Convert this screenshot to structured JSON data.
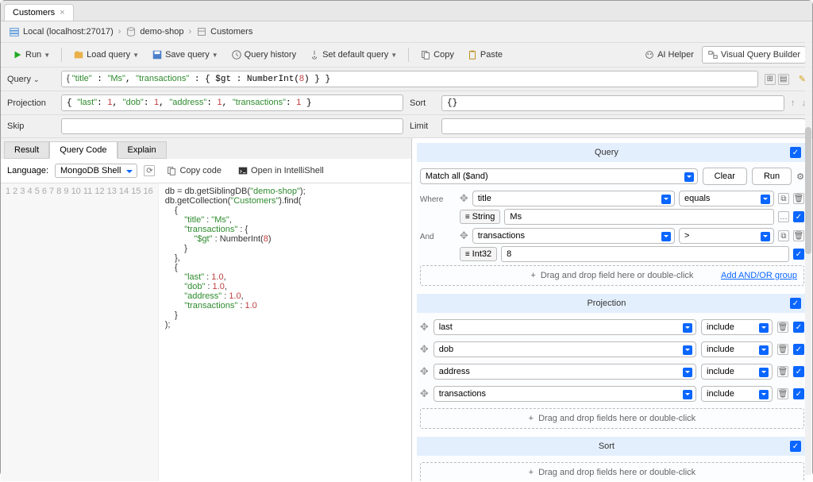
{
  "tab": {
    "title": "Customers"
  },
  "breadcrumb": {
    "host": "Local (localhost:27017)",
    "db": "demo-shop",
    "coll": "Customers"
  },
  "toolbar": {
    "run": "Run",
    "load": "Load query",
    "save": "Save query",
    "history": "Query history",
    "default": "Set default query",
    "copy": "Copy",
    "paste": "Paste",
    "ai": "AI Helper",
    "vqb": "Visual Query Builder"
  },
  "query": {
    "label": "Query",
    "value": "{ \"title\" : \"Ms\", \"transactions\" : { $gt : NumberInt(8) } }"
  },
  "projection": {
    "label": "Projection",
    "value": "{ \"last\": 1, \"dob\": 1, \"address\": 1, \"transactions\": 1 }"
  },
  "sort": {
    "label": "Sort",
    "value": "{}"
  },
  "skip": {
    "label": "Skip",
    "value": ""
  },
  "limit": {
    "label": "Limit",
    "value": ""
  },
  "restabs": {
    "result": "Result",
    "code": "Query Code",
    "explain": "Explain"
  },
  "lang": {
    "label": "Language:",
    "value": "MongoDB Shell",
    "copy": "Copy code",
    "open": "Open in IntelliShell"
  },
  "code_lines": 16,
  "vqb_panel": {
    "query_hdr": "Query",
    "match": "Match all ($and)",
    "clear": "Clear",
    "run": "Run",
    "where": "Where",
    "and": "And",
    "cond1": {
      "field": "title",
      "op": "equals",
      "type": "String",
      "val": "Ms"
    },
    "cond2": {
      "field": "transactions",
      "op": ">",
      "type": "Int32",
      "val": "8"
    },
    "drop1": "Drag and drop field here or double-click",
    "addgrp": "Add AND/OR group",
    "proj_hdr": "Projection",
    "proj": [
      {
        "field": "last",
        "mode": "include"
      },
      {
        "field": "dob",
        "mode": "include"
      },
      {
        "field": "address",
        "mode": "include"
      },
      {
        "field": "transactions",
        "mode": "include"
      }
    ],
    "drop2": "Drag and drop fields here or double-click",
    "sort_hdr": "Sort",
    "drop3": "Drag and drop fields here or double-click"
  }
}
